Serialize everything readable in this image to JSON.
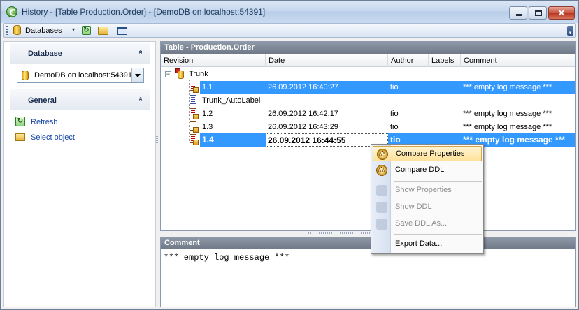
{
  "window": {
    "title": "History - [Table Production.Order] - [DemoDB on localhost:54391]",
    "close_glyph": "✕"
  },
  "toolbar": {
    "databases_label": "Databases",
    "caret": "▾",
    "refresh_glyph": "↻"
  },
  "left_panel": {
    "database_section": {
      "label": "Database",
      "chevron": "»"
    },
    "database_select": {
      "value": "DemoDB on localhost:54391"
    },
    "general_section": {
      "label": "General",
      "chevron": "»"
    },
    "links": [
      {
        "label": "Refresh",
        "icon": "refresh-icon"
      },
      {
        "label": "Select object",
        "icon": "folder-open-icon"
      }
    ]
  },
  "table_panel": {
    "title": "Table - Production.Order",
    "columns": [
      "Revision",
      "Date",
      "Author",
      "Labels",
      "Comment"
    ],
    "rows": [
      {
        "revision": "Trunk",
        "date": "",
        "author": "",
        "labels": "",
        "comment": "",
        "kind": "trunk"
      },
      {
        "revision": "1.1",
        "date": "26.09.2012 16:40:27",
        "author": "tio",
        "labels": "",
        "comment": "*** empty log message ***",
        "kind": "rev"
      },
      {
        "revision": "Trunk_AutoLabel",
        "date": "",
        "author": "",
        "labels": "",
        "comment": "",
        "kind": "branch"
      },
      {
        "revision": "1.2",
        "date": "26.09.2012 16:42:17",
        "author": "tio",
        "labels": "",
        "comment": "*** empty log message ***",
        "kind": "rev"
      },
      {
        "revision": "1.3",
        "date": "26.09.2012 16:43:29",
        "author": "tio",
        "labels": "",
        "comment": "*** empty log message ***",
        "kind": "rev"
      },
      {
        "revision": "1.4",
        "date": "26.09.2012 16:44:55",
        "author": "tio",
        "labels": "",
        "comment": "*** empty log message ***",
        "kind": "rev"
      }
    ],
    "expander": "−"
  },
  "comment_panel": {
    "title": "Comment",
    "text": "*** empty log message ***"
  },
  "context_menu": {
    "items": [
      {
        "label": "Compare Properties",
        "enabled": true,
        "icon": "compare-icon"
      },
      {
        "label": "Compare DDL",
        "enabled": true,
        "icon": "compare-icon"
      },
      {
        "label": "Show Properties",
        "enabled": false,
        "icon": "properties-icon"
      },
      {
        "label": "Show DDL",
        "enabled": false,
        "icon": "ddl-icon"
      },
      {
        "label": "Save DDL As...",
        "enabled": false,
        "icon": "save-icon"
      },
      {
        "label": "Export Data...",
        "enabled": true,
        "icon": ""
      }
    ]
  },
  "colors": {
    "selection": "#3399ff",
    "panel_title": "#7b8594",
    "link": "#1646a8",
    "menu_hover": "#ffe29a"
  }
}
